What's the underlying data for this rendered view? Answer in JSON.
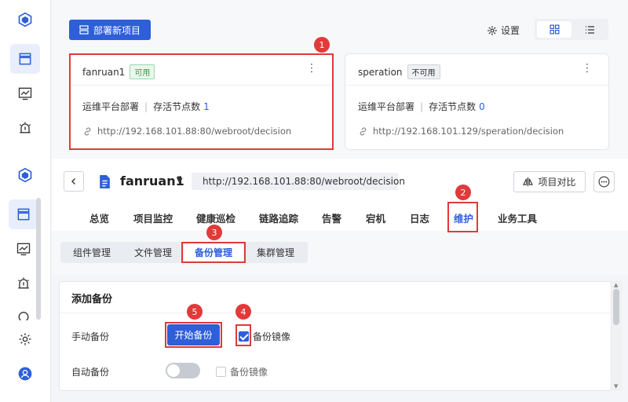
{
  "toolbar": {
    "deploy_label": "部署新项目",
    "settings_label": "设置"
  },
  "cards": [
    {
      "name": "fanruan1",
      "status": "可用",
      "platform": "运维平台部署",
      "nodes_label": "存活节点数",
      "nodes": "1",
      "url": "http://192.168.101.88:80/webroot/decision"
    },
    {
      "name": "speration",
      "status": "不可用",
      "platform": "运维平台部署",
      "nodes_label": "存活节点数",
      "nodes": "0",
      "url": "http://192.168.101.129/speration/decision"
    }
  ],
  "project": {
    "name": "fanruan1",
    "url": "http://192.168.101.88:80/webroot/decision",
    "compare_label": "项目对比"
  },
  "tabs": [
    "总览",
    "项目监控",
    "健康巡检",
    "链路追踪",
    "告警",
    "宕机",
    "日志",
    "维护",
    "业务工具"
  ],
  "subtabs": [
    "组件管理",
    "文件管理",
    "备份管理",
    "集群管理"
  ],
  "backup": {
    "section_title": "添加备份",
    "manual_label": "手动备份",
    "start_label": "开始备份",
    "mirror_label": "备份镜像",
    "auto_label": "自动备份",
    "auto_mirror_label": "备份镜像"
  },
  "markers": [
    "1",
    "2",
    "3",
    "4",
    "5"
  ],
  "colors": {
    "primary": "#2e5fd8",
    "marker": "#e03a3a"
  }
}
